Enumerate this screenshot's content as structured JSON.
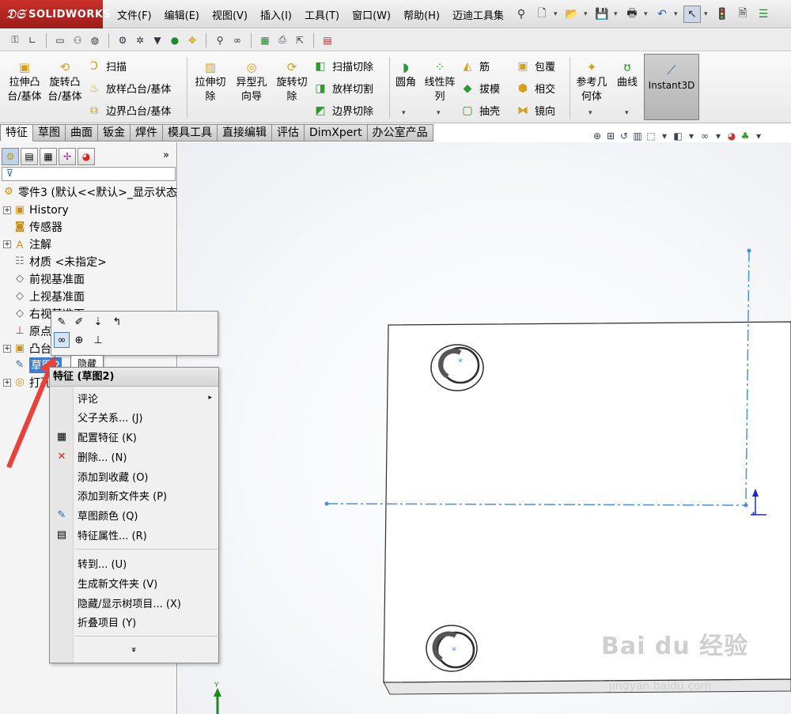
{
  "app": {
    "brand": "SOLIDWORKS",
    "menus": [
      "文件(F)",
      "编辑(E)",
      "视图(V)",
      "插入(I)",
      "工具(T)",
      "窗口(W)",
      "帮助(H)",
      "迈迪工具集"
    ]
  },
  "ribbon": {
    "extrude_boss": "拉伸凸台/基体",
    "revolve_boss": "旋转凸台/基体",
    "sweep": "扫描",
    "loft_boss": "放样凸台/基体",
    "boundary_boss": "边界凸台/基体",
    "extrude_cut": "拉伸切除",
    "hole_wizard": "异型孔向导",
    "revolve_cut": "旋转切除",
    "swept_cut": "扫描切除",
    "lofted_cut": "放样切割",
    "boundary_cut": "边界切除",
    "fillet": "圆角",
    "linear_pattern": "线性阵列",
    "rib": "筋",
    "wrap": "包覆",
    "draft": "拔模",
    "intersect": "相交",
    "shell": "抽壳",
    "mirror": "镜向",
    "reference_geometry": "参考几何体",
    "curves": "曲线",
    "instant3d": "Instant3D"
  },
  "tabs": [
    "特征",
    "草图",
    "曲面",
    "钣金",
    "焊件",
    "模具工具",
    "直接编辑",
    "评估",
    "DimXpert",
    "办公室产品"
  ],
  "tree": {
    "root": "零件3 (默认<<默认>_显示状态",
    "items": [
      "History",
      "传感器",
      "注解",
      "材质 <未指定>",
      "前视基准面",
      "上视基准面",
      "右视基准面",
      "原点",
      "凸台",
      "草图2",
      "打孔"
    ]
  },
  "tooltip": "隐藏",
  "context_menu": {
    "title": "特征 (草图2)",
    "items": [
      "评论",
      "父子关系... (J)",
      "配置特征 (K)",
      "删除... (N)",
      "添加到收藏 (O)",
      "添加到新文件夹 (P)",
      "草图颜色 (Q)",
      "特征属性... (R)",
      "转到... (U)",
      "生成新文件夹 (V)",
      "隐藏/显示树项目... (X)",
      "折叠项目 (Y)"
    ],
    "more": "»"
  },
  "watermark": {
    "main": "Bai du 经验",
    "sub": "jingyan.baidu.com"
  },
  "colors": {
    "selection": "#3a7fd4",
    "sketch_line": "#4a90e2",
    "annotation_arrow": "#e8423a"
  }
}
